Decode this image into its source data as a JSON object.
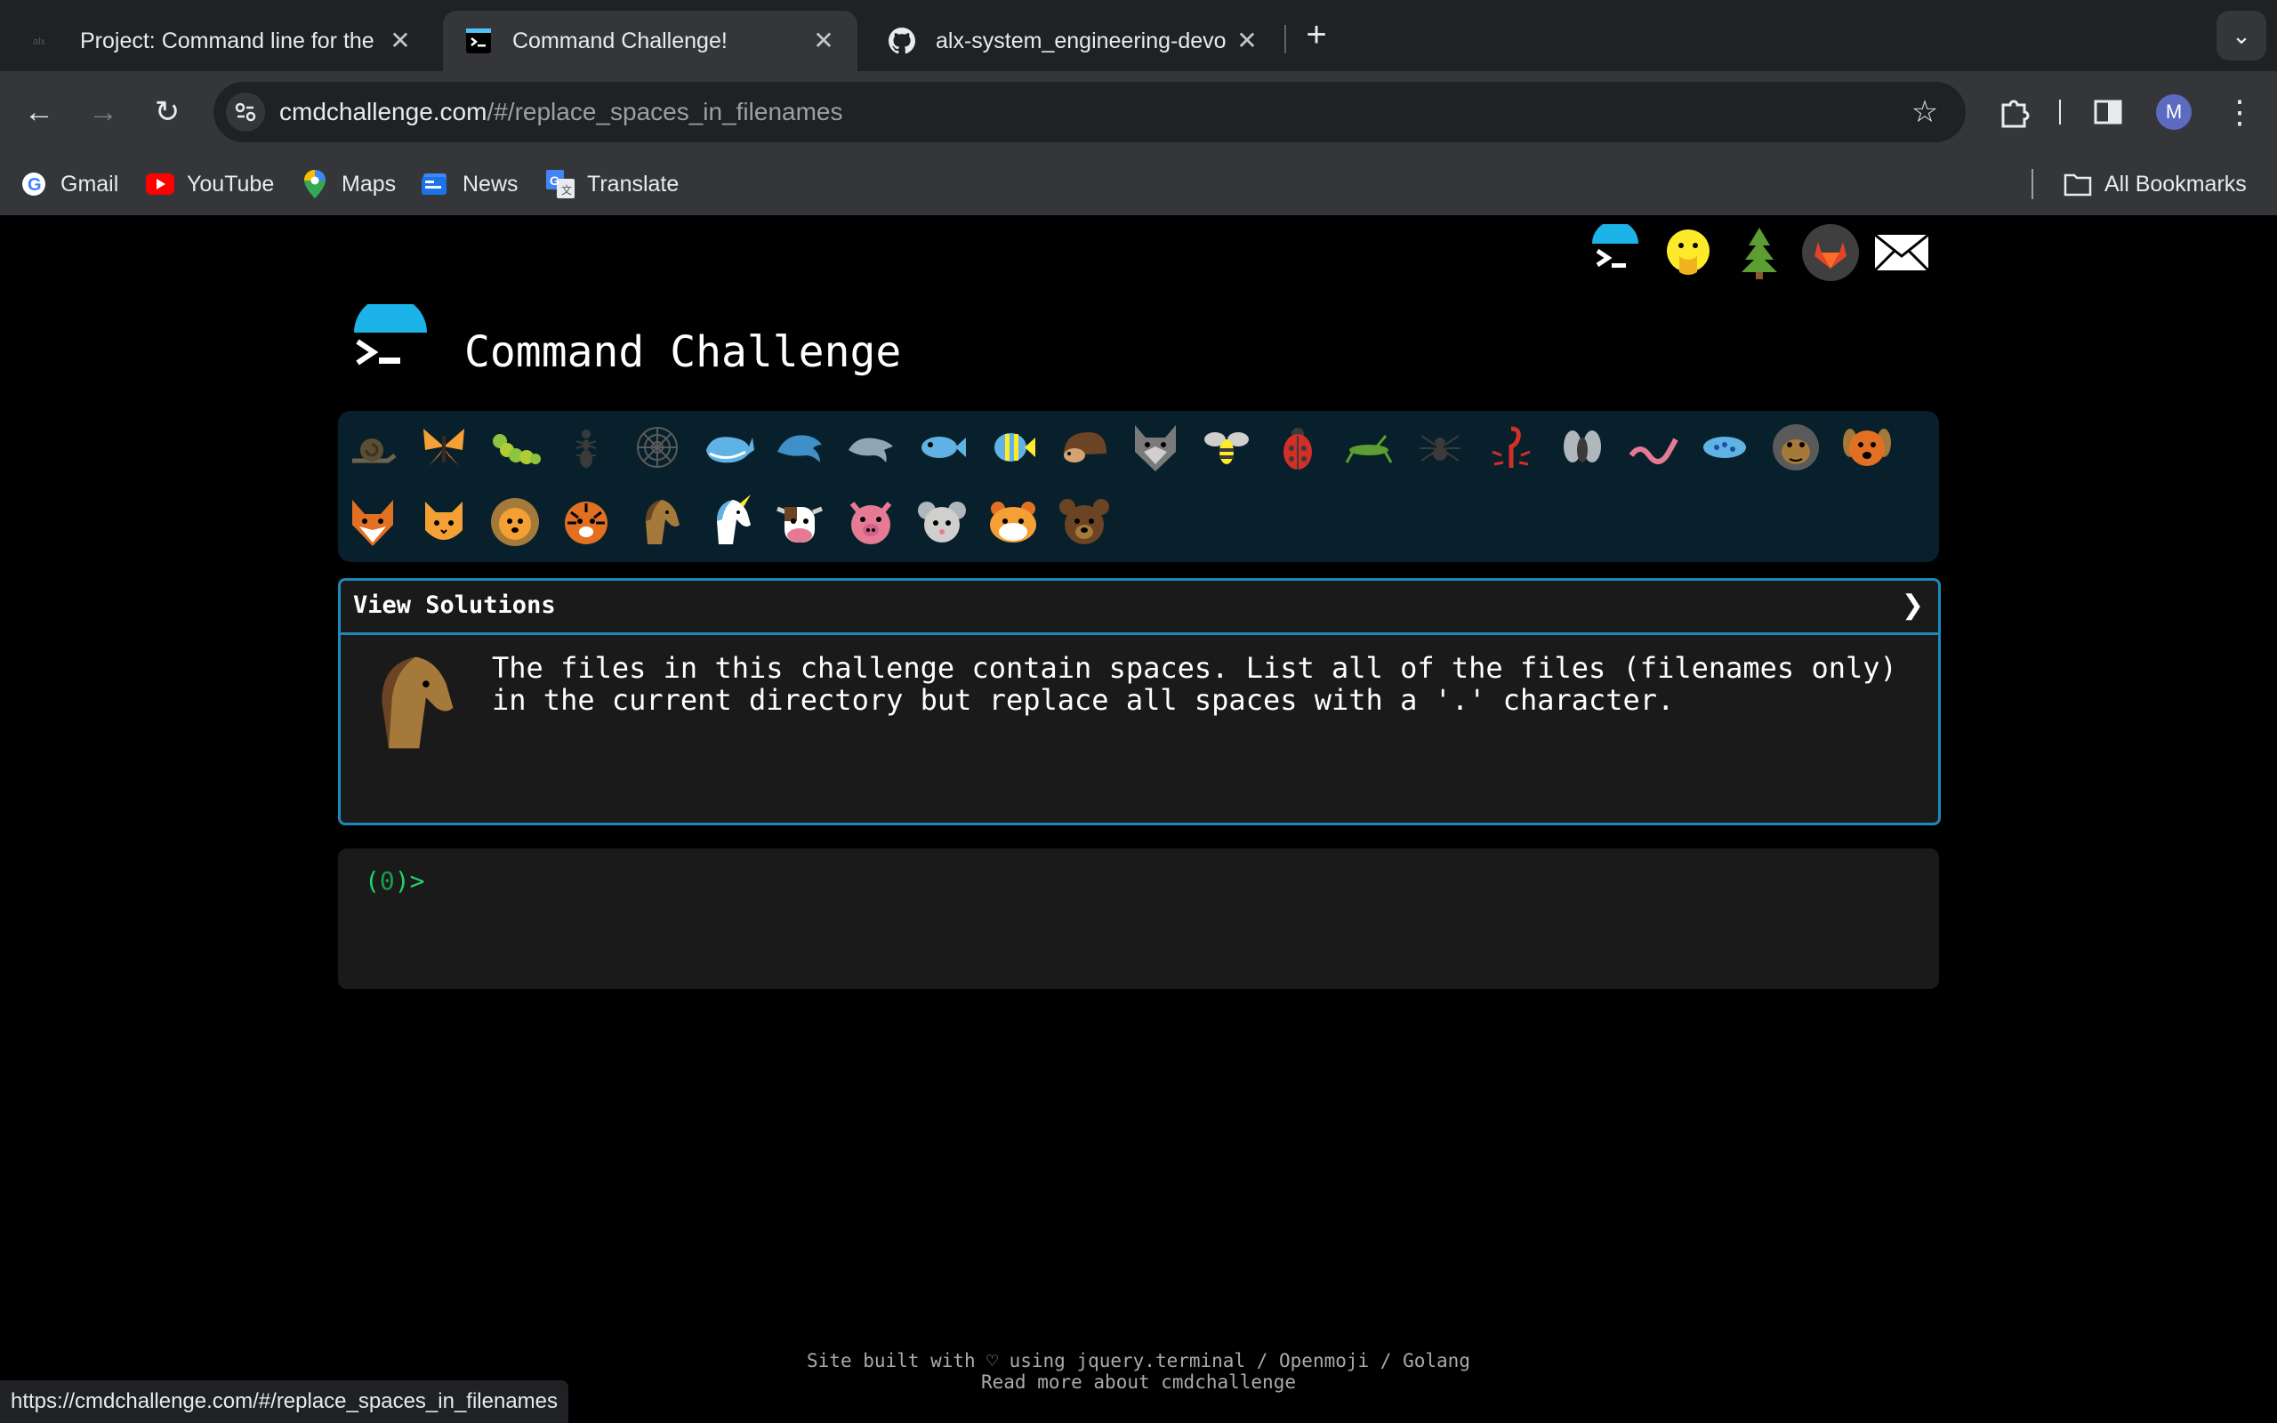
{
  "browser": {
    "tabs": [
      {
        "title": "Project: Command line for the",
        "favicon": "alx-logo-icon",
        "active": false
      },
      {
        "title": "Command Challenge!",
        "favicon": "terminal-icon",
        "active": true
      },
      {
        "title": "alx-system_engineering-devo",
        "favicon": "github-icon",
        "active": false
      }
    ],
    "address": {
      "host": "cmdchallenge.com",
      "path": "/#/replace_spaces_in_filenames"
    },
    "bookmarks": [
      "Gmail",
      "YouTube",
      "Maps",
      "News",
      "Translate"
    ],
    "all_bookmarks": "All Bookmarks",
    "profile_initial": "M",
    "status_url": "https://cmdchallenge.com/#/replace_spaces_in_filenames"
  },
  "page": {
    "title": "Command Challenge",
    "header_icons": [
      "terminal-icon",
      "face-hand-over-mouth-icon",
      "tree-icon",
      "gitlab-icon",
      "mail-icon"
    ],
    "animals": [
      "snail",
      "butterfly",
      "caterpillar",
      "ant",
      "spider-web",
      "whale",
      "dolphin",
      "dolphin",
      "fish",
      "tropical-fish",
      "hedgehog",
      "wolf",
      "bee",
      "ladybug",
      "cricket",
      "spider",
      "scorpion",
      "fly",
      "worm",
      "microbe",
      "gorilla",
      "dog",
      "fox",
      "cat",
      "lion",
      "tiger",
      "horse",
      "unicorn",
      "cow",
      "pig",
      "mouse",
      "hamster",
      "bear"
    ],
    "view_solutions": "View Solutions",
    "collapse_arrow": "❯",
    "description": "The files in this challenge contain spaces. List all of the files (filenames only) in the current directory but replace all spaces with a '.' character.",
    "prompt_open": "(",
    "prompt_num": "0",
    "prompt_close": ")>",
    "footer_line1": "Site built with ♡ using jquery.terminal / Openmoji / Golang",
    "footer_line2": "Read more about cmdchallenge"
  }
}
